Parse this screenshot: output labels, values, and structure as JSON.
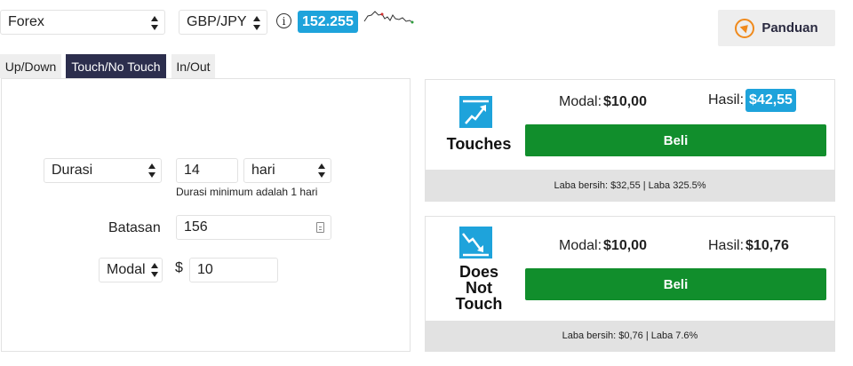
{
  "top": {
    "market_select": "Forex",
    "asset_select": "GBP/JPY",
    "info_icon": "info-icon",
    "spot_price": "152.255",
    "guide_button": "Panduan",
    "colors": {
      "accent": "#1ea3db",
      "guide_icon": "#f08a1c"
    }
  },
  "tabs": [
    {
      "label": "Up/Down",
      "active": false
    },
    {
      "label": "Touch/No Touch",
      "active": true
    },
    {
      "label": "In/Out",
      "active": false
    }
  ],
  "form": {
    "duration_type": "Durasi",
    "duration_value": "14",
    "duration_unit": "hari",
    "duration_hint": "Durasi minimum adalah 1 hari",
    "barrier_label": "Batasan",
    "barrier_value": "156",
    "amount_type": "Modal",
    "currency_symbol": "$",
    "amount_value": "10"
  },
  "options": [
    {
      "title": "Touches",
      "icon": "touches-icon",
      "stake_label": "Modal:",
      "stake_value": "$10,00",
      "payout_label": "Hasil:",
      "payout_value": "$42,55",
      "buy_label": "Beli",
      "footer": "Laba bersih: $32,55 | Laba 325.5%"
    },
    {
      "title": "Does Not Touch",
      "title_lines": [
        "Does",
        "Not",
        "Touch"
      ],
      "icon": "does-not-touch-icon",
      "stake_label": "Modal:",
      "stake_value": "$10,00",
      "payout_label": "Hasil:",
      "payout_value": "$10,76",
      "buy_label": "Beli",
      "footer": "Laba bersih: $0,76 | Laba 7.6%"
    }
  ],
  "colors": {
    "buy": "#118e2c",
    "active_tab": "#2c2e4d"
  }
}
